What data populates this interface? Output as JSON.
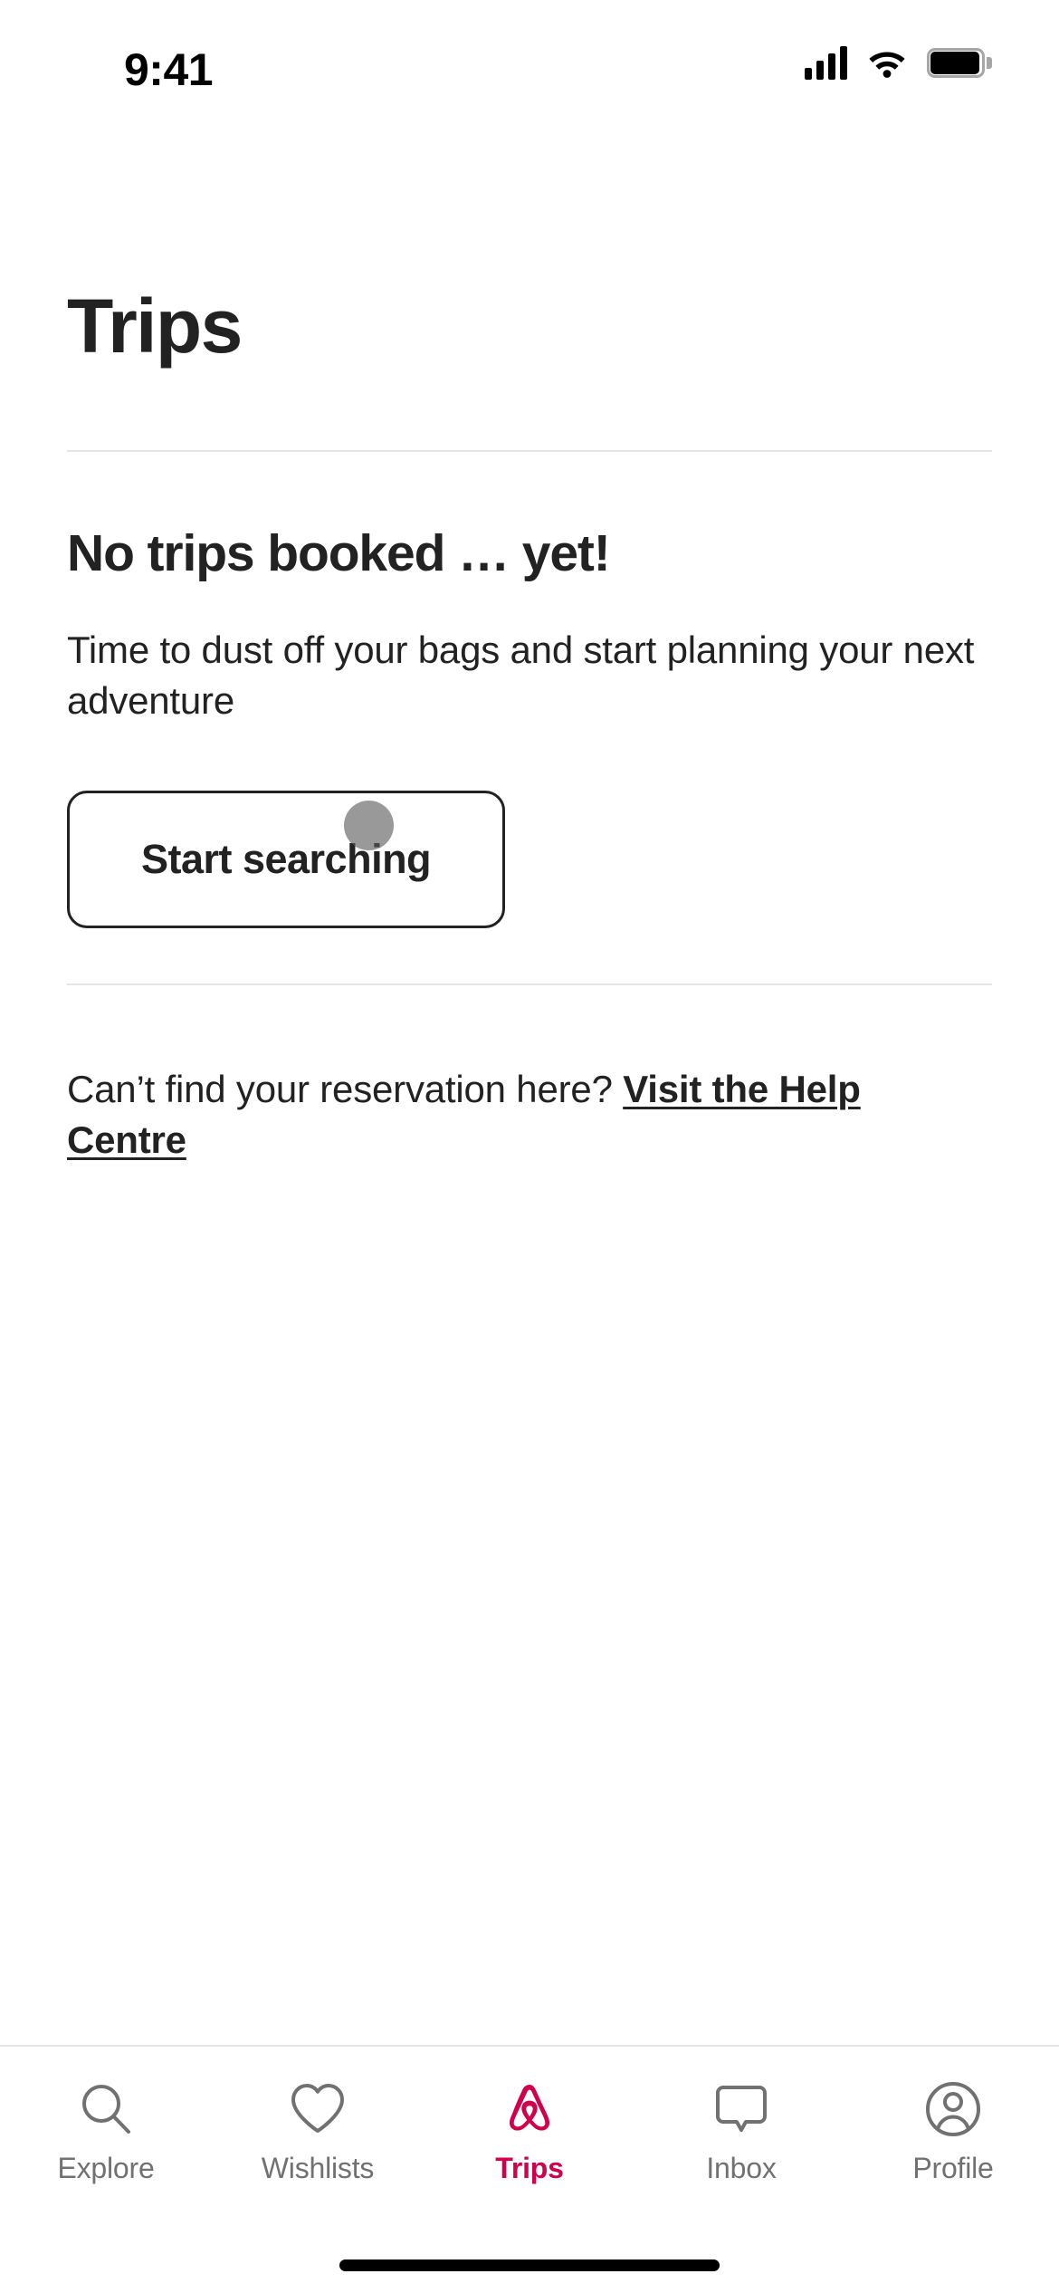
{
  "status_bar": {
    "time": "9:41",
    "icons": [
      "cellular-signal-icon",
      "wifi-icon",
      "battery-icon"
    ]
  },
  "header": {
    "title": "Trips"
  },
  "empty_state": {
    "title": "No trips booked … yet!",
    "body": "Time to dust off your bags and start planning your next adventure",
    "button_label": "Start searching"
  },
  "help": {
    "prefix": "Can’t find your reservation here? ",
    "link_label": "Visit the Help Centre"
  },
  "tab_bar": {
    "active_color": "#D1004B",
    "inactive_color": "#717171",
    "items": [
      {
        "label": "Explore",
        "icon": "search-icon",
        "active": false
      },
      {
        "label": "Wishlists",
        "icon": "heart-icon",
        "active": false
      },
      {
        "label": "Trips",
        "icon": "airbnb-belo-icon",
        "active": true
      },
      {
        "label": "Inbox",
        "icon": "speech-bubble-icon",
        "active": false
      },
      {
        "label": "Profile",
        "icon": "user-circle-icon",
        "active": false
      }
    ]
  }
}
